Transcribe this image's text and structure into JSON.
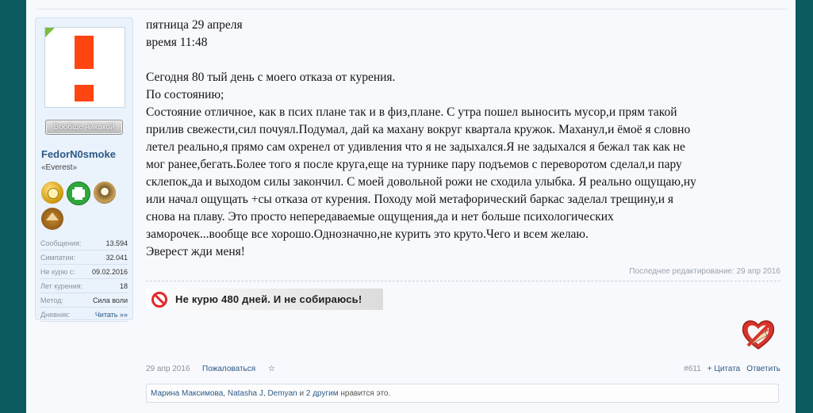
{
  "sidebar": {
    "status_button": "Вообще никакой",
    "username": "FedorN0smoke",
    "user_title": "«Everest»",
    "stats": [
      {
        "label": "Сообщения:",
        "value": "13.594"
      },
      {
        "label": "Симпатии:",
        "value": "32.041"
      },
      {
        "label": "Не курю с:",
        "value": "09.02.2016"
      },
      {
        "label": "Лет курения:",
        "value": "18"
      },
      {
        "label": "Метод:",
        "value": "Сила воли"
      },
      {
        "label": "Дневник:",
        "value": "Читать »»"
      }
    ]
  },
  "post": {
    "lines": [
      "пятница 29 апреля",
      "время 11:48",
      "",
      "Сегодня 80 тый день с моего отказа от курения.",
      "По состоянию;",
      "Состояние отличное, как в псих плане так и в физ,плане. С утра пошел выносить мусор,и прям такой",
      "прилив свежести,сил почуял.Подумал, дай ка махану вокруг квартала кружок. Маханул,и ёмоё я словно",
      "летел реально,я прямо сам охренел от удивления что я не задыхался.Я не задыхался я бежал так как не",
      "мог ранее,бегать.Более того я после круга,еще на турнике пару подъемов с переворотом сделал,и пару",
      "склепок,да и выходом силы закончил. С моей довольной рожи не сходила улыбка. Я реально ощущаю,ну",
      "или начал ощущать +сы отказа от курения. Походу мой метафорический баркас заделал трещину,и я",
      "снова на плаву. Это просто непередаваемые ощущения,да и нет больше психологических",
      "заморочек...вообще все хорошо.Однозначно,не курить это круто.Чего и всем желаю.",
      "Эверест жди меня!"
    ],
    "last_edited": "Последнее редактирование: 29 апр 2016",
    "signature": "Не курю 480 дней. И не собираюсь!",
    "date": "29 апр 2016",
    "report_link": "Пожаловаться",
    "star_icon": "☆",
    "post_number": "#611",
    "quote_link": "+ Цитата",
    "reply_link": "Ответить"
  },
  "likes": {
    "users": [
      "Марина Максимова",
      "Natasha J",
      "Demyan"
    ],
    "separator": ", ",
    "and_text": " и ",
    "others_link": "2 другим",
    "suffix": " нравится это."
  }
}
